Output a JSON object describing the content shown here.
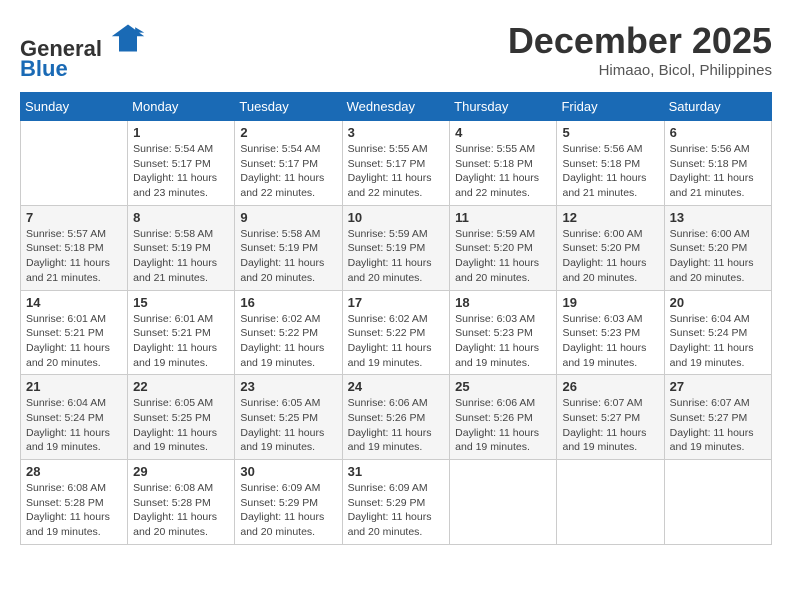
{
  "header": {
    "logo_line1": "General",
    "logo_line2": "Blue",
    "month": "December 2025",
    "location": "Himaao, Bicol, Philippines"
  },
  "weekdays": [
    "Sunday",
    "Monday",
    "Tuesday",
    "Wednesday",
    "Thursday",
    "Friday",
    "Saturday"
  ],
  "weeks": [
    [
      {
        "day": "",
        "info": ""
      },
      {
        "day": "1",
        "info": "Sunrise: 5:54 AM\nSunset: 5:17 PM\nDaylight: 11 hours\nand 23 minutes."
      },
      {
        "day": "2",
        "info": "Sunrise: 5:54 AM\nSunset: 5:17 PM\nDaylight: 11 hours\nand 22 minutes."
      },
      {
        "day": "3",
        "info": "Sunrise: 5:55 AM\nSunset: 5:17 PM\nDaylight: 11 hours\nand 22 minutes."
      },
      {
        "day": "4",
        "info": "Sunrise: 5:55 AM\nSunset: 5:18 PM\nDaylight: 11 hours\nand 22 minutes."
      },
      {
        "day": "5",
        "info": "Sunrise: 5:56 AM\nSunset: 5:18 PM\nDaylight: 11 hours\nand 21 minutes."
      },
      {
        "day": "6",
        "info": "Sunrise: 5:56 AM\nSunset: 5:18 PM\nDaylight: 11 hours\nand 21 minutes."
      }
    ],
    [
      {
        "day": "7",
        "info": "Sunrise: 5:57 AM\nSunset: 5:18 PM\nDaylight: 11 hours\nand 21 minutes."
      },
      {
        "day": "8",
        "info": "Sunrise: 5:58 AM\nSunset: 5:19 PM\nDaylight: 11 hours\nand 21 minutes."
      },
      {
        "day": "9",
        "info": "Sunrise: 5:58 AM\nSunset: 5:19 PM\nDaylight: 11 hours\nand 20 minutes."
      },
      {
        "day": "10",
        "info": "Sunrise: 5:59 AM\nSunset: 5:19 PM\nDaylight: 11 hours\nand 20 minutes."
      },
      {
        "day": "11",
        "info": "Sunrise: 5:59 AM\nSunset: 5:20 PM\nDaylight: 11 hours\nand 20 minutes."
      },
      {
        "day": "12",
        "info": "Sunrise: 6:00 AM\nSunset: 5:20 PM\nDaylight: 11 hours\nand 20 minutes."
      },
      {
        "day": "13",
        "info": "Sunrise: 6:00 AM\nSunset: 5:20 PM\nDaylight: 11 hours\nand 20 minutes."
      }
    ],
    [
      {
        "day": "14",
        "info": "Sunrise: 6:01 AM\nSunset: 5:21 PM\nDaylight: 11 hours\nand 20 minutes."
      },
      {
        "day": "15",
        "info": "Sunrise: 6:01 AM\nSunset: 5:21 PM\nDaylight: 11 hours\nand 19 minutes."
      },
      {
        "day": "16",
        "info": "Sunrise: 6:02 AM\nSunset: 5:22 PM\nDaylight: 11 hours\nand 19 minutes."
      },
      {
        "day": "17",
        "info": "Sunrise: 6:02 AM\nSunset: 5:22 PM\nDaylight: 11 hours\nand 19 minutes."
      },
      {
        "day": "18",
        "info": "Sunrise: 6:03 AM\nSunset: 5:23 PM\nDaylight: 11 hours\nand 19 minutes."
      },
      {
        "day": "19",
        "info": "Sunrise: 6:03 AM\nSunset: 5:23 PM\nDaylight: 11 hours\nand 19 minutes."
      },
      {
        "day": "20",
        "info": "Sunrise: 6:04 AM\nSunset: 5:24 PM\nDaylight: 11 hours\nand 19 minutes."
      }
    ],
    [
      {
        "day": "21",
        "info": "Sunrise: 6:04 AM\nSunset: 5:24 PM\nDaylight: 11 hours\nand 19 minutes."
      },
      {
        "day": "22",
        "info": "Sunrise: 6:05 AM\nSunset: 5:25 PM\nDaylight: 11 hours\nand 19 minutes."
      },
      {
        "day": "23",
        "info": "Sunrise: 6:05 AM\nSunset: 5:25 PM\nDaylight: 11 hours\nand 19 minutes."
      },
      {
        "day": "24",
        "info": "Sunrise: 6:06 AM\nSunset: 5:26 PM\nDaylight: 11 hours\nand 19 minutes."
      },
      {
        "day": "25",
        "info": "Sunrise: 6:06 AM\nSunset: 5:26 PM\nDaylight: 11 hours\nand 19 minutes."
      },
      {
        "day": "26",
        "info": "Sunrise: 6:07 AM\nSunset: 5:27 PM\nDaylight: 11 hours\nand 19 minutes."
      },
      {
        "day": "27",
        "info": "Sunrise: 6:07 AM\nSunset: 5:27 PM\nDaylight: 11 hours\nand 19 minutes."
      }
    ],
    [
      {
        "day": "28",
        "info": "Sunrise: 6:08 AM\nSunset: 5:28 PM\nDaylight: 11 hours\nand 19 minutes."
      },
      {
        "day": "29",
        "info": "Sunrise: 6:08 AM\nSunset: 5:28 PM\nDaylight: 11 hours\nand 20 minutes."
      },
      {
        "day": "30",
        "info": "Sunrise: 6:09 AM\nSunset: 5:29 PM\nDaylight: 11 hours\nand 20 minutes."
      },
      {
        "day": "31",
        "info": "Sunrise: 6:09 AM\nSunset: 5:29 PM\nDaylight: 11 hours\nand 20 minutes."
      },
      {
        "day": "",
        "info": ""
      },
      {
        "day": "",
        "info": ""
      },
      {
        "day": "",
        "info": ""
      }
    ]
  ]
}
